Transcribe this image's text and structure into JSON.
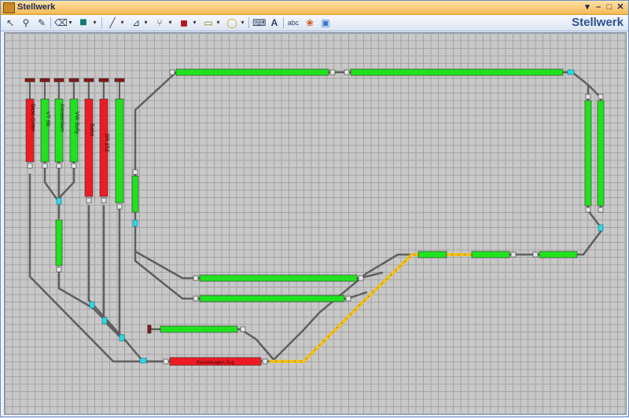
{
  "window": {
    "title": "Stellwerk",
    "controls": [
      "▾",
      "–",
      "□",
      "✕"
    ]
  },
  "toolbar": {
    "brand": "Stellwerk",
    "tools": [
      {
        "name": "select-arrow-icon",
        "glyph": "↖"
      },
      {
        "name": "connect-tool-icon",
        "glyph": "⚲"
      },
      {
        "name": "pencil-icon",
        "glyph": "✎"
      },
      {
        "name": "eraser-icon",
        "glyph": "⌫"
      },
      {
        "name": "color-swatch-icon",
        "glyph": "■"
      },
      {
        "name": "track-straight-icon",
        "glyph": "╱"
      },
      {
        "name": "track-end-icon",
        "glyph": "⊿"
      },
      {
        "name": "switch-icon",
        "glyph": "⑂"
      },
      {
        "name": "signal-icon",
        "glyph": "◼"
      },
      {
        "name": "block-icon",
        "glyph": "▭"
      },
      {
        "name": "lamp-icon",
        "glyph": "◯"
      },
      {
        "name": "text-field-icon",
        "glyph": "⌨"
      },
      {
        "name": "label-icon",
        "glyph": "A"
      },
      {
        "name": "abc-icon",
        "glyph": "abc"
      },
      {
        "name": "palette-icon",
        "glyph": "❀"
      },
      {
        "name": "image-icon",
        "glyph": "▣"
      }
    ]
  },
  "colors": {
    "free": "#21e21f",
    "occupied": "#ef1b24",
    "route": "#f3c01f",
    "track": "#5f5f5f",
    "switch": "#2ed9e6",
    "accent": "#2d4f8e"
  },
  "blocks": {
    "vertical": [
      {
        "label": "Beso Güter",
        "state": "occupied"
      },
      {
        "label": "VT 98",
        "state": "free"
      },
      {
        "label": "Amsterdam",
        "state": "free"
      },
      {
        "label": "VW Bully",
        "state": "free"
      },
      {
        "label": "Bahn",
        "state": "occupied"
      },
      {
        "label": "BR 152",
        "state": "occupied"
      },
      {
        "label": "",
        "state": "free"
      }
    ],
    "bottom_train": "Kesselwagen Zug"
  }
}
